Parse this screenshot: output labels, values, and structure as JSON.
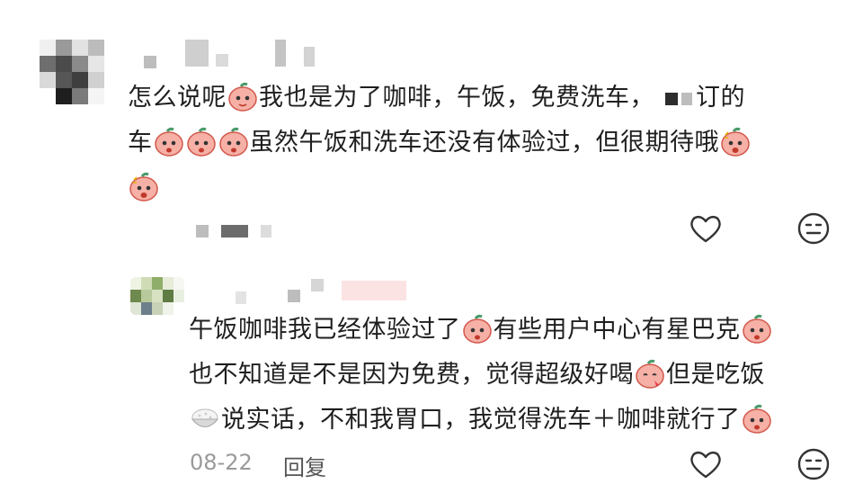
{
  "comment": {
    "text_part1": "怎么说呢",
    "text_part2": "我也是为了咖啡，午饭，免费洗车，",
    "text_part3": "订的",
    "text_part4": "车",
    "text_part5": "虽然午饭和洗车还没有体验过，但很期待哦"
  },
  "reply": {
    "text_part1": "午饭咖啡我已经体验过了",
    "text_part2": "有些用户中心有星巴克",
    "text_part3": "也不知道是不是因为免费，觉得超级好喝",
    "text_part4": "但是吃饭",
    "text_part5": "说实话，不和我胃口，我觉得洗车＋咖啡就行了",
    "date": "08-22",
    "reply_label": "回复"
  },
  "icons": {
    "like": "heart-outline-icon",
    "dislike": "meh-face-icon",
    "emoji": "peach-face-emoji",
    "rice": "rice-bowl-emoji"
  },
  "colors": {
    "text": "#1f1f1f",
    "meta": "#9a9a9a",
    "icon": "#333333",
    "emoji_fill": "#f6b0a6"
  }
}
